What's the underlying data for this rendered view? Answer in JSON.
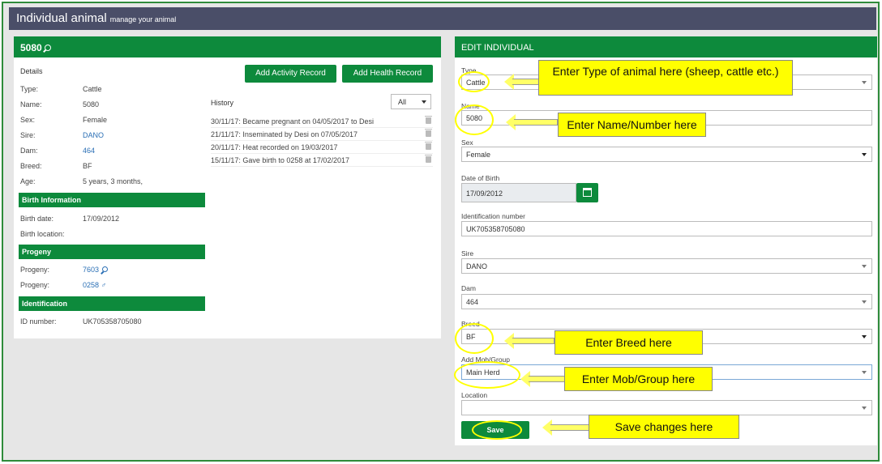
{
  "colors": {
    "brand_green": "#0d8a3c",
    "header_bar": "#4a4e68",
    "link_blue": "#2a6fb5",
    "callout_yellow": "#ffff00"
  },
  "header": {
    "title": "Individual animal",
    "subtitle": "manage your animal"
  },
  "left": {
    "animal_id": "5080",
    "details_label": "Details",
    "details": [
      {
        "label": "Type:",
        "value": "Cattle"
      },
      {
        "label": "Name:",
        "value": "5080"
      },
      {
        "label": "Sex:",
        "value": "Female"
      },
      {
        "label": "Sire:",
        "value": "DANO"
      },
      {
        "label": "Dam:",
        "value": "464"
      },
      {
        "label": "Breed:",
        "value": "BF"
      },
      {
        "label": "Age:",
        "value": "5 years, 3 months,"
      }
    ],
    "birth": {
      "title": "Birth Information",
      "date_label": "Birth date:",
      "date_value": "17/09/2012",
      "location_label": "Birth location:"
    },
    "progeny": {
      "title": "Progeny",
      "items": [
        {
          "label": "Progeny:",
          "value": "7603",
          "icon": "search-icon"
        },
        {
          "label": "Progeny:",
          "value": "0258",
          "icon": "male-icon"
        }
      ]
    },
    "identification": {
      "title": "Identification",
      "label": "ID number:",
      "value": "UK705358705080"
    },
    "buttons": {
      "activity": "Add Activity Record",
      "health": "Add Health Record"
    },
    "history": {
      "label": "History",
      "filter": "All",
      "rows": [
        "30/11/17: Became pregnant on 04/05/2017 to Desi",
        "21/11/17: Inseminated by Desi on 07/05/2017",
        "20/11/17: Heat recorded on 19/03/2017",
        "15/11/17: Gave birth to 0258 at 17/02/2017"
      ]
    }
  },
  "right": {
    "title": "EDIT INDIVIDUAL",
    "fields": {
      "type": {
        "label": "Type",
        "value": "Cattle"
      },
      "name": {
        "label": "Name",
        "value": "5080"
      },
      "sex": {
        "label": "Sex",
        "value": "Female"
      },
      "dob": {
        "label": "Date of Birth",
        "value": "17/09/2012"
      },
      "ident": {
        "label": "Identification number",
        "value": "UK705358705080"
      },
      "sire": {
        "label": "Sire",
        "value": "DANO"
      },
      "dam": {
        "label": "Dam",
        "value": "464"
      },
      "breed": {
        "label": "Breed",
        "value": "BF"
      },
      "group": {
        "label": "Add Mob/Group",
        "value": "Main Herd"
      },
      "location": {
        "label": "Location",
        "value": ""
      }
    },
    "save": "Save"
  },
  "callouts": {
    "type": "Enter Type of animal here (sheep, cattle etc.)",
    "name": "Enter Name/Number here",
    "breed": "Enter Breed here",
    "group": "Enter Mob/Group here",
    "save": "Save changes here"
  }
}
